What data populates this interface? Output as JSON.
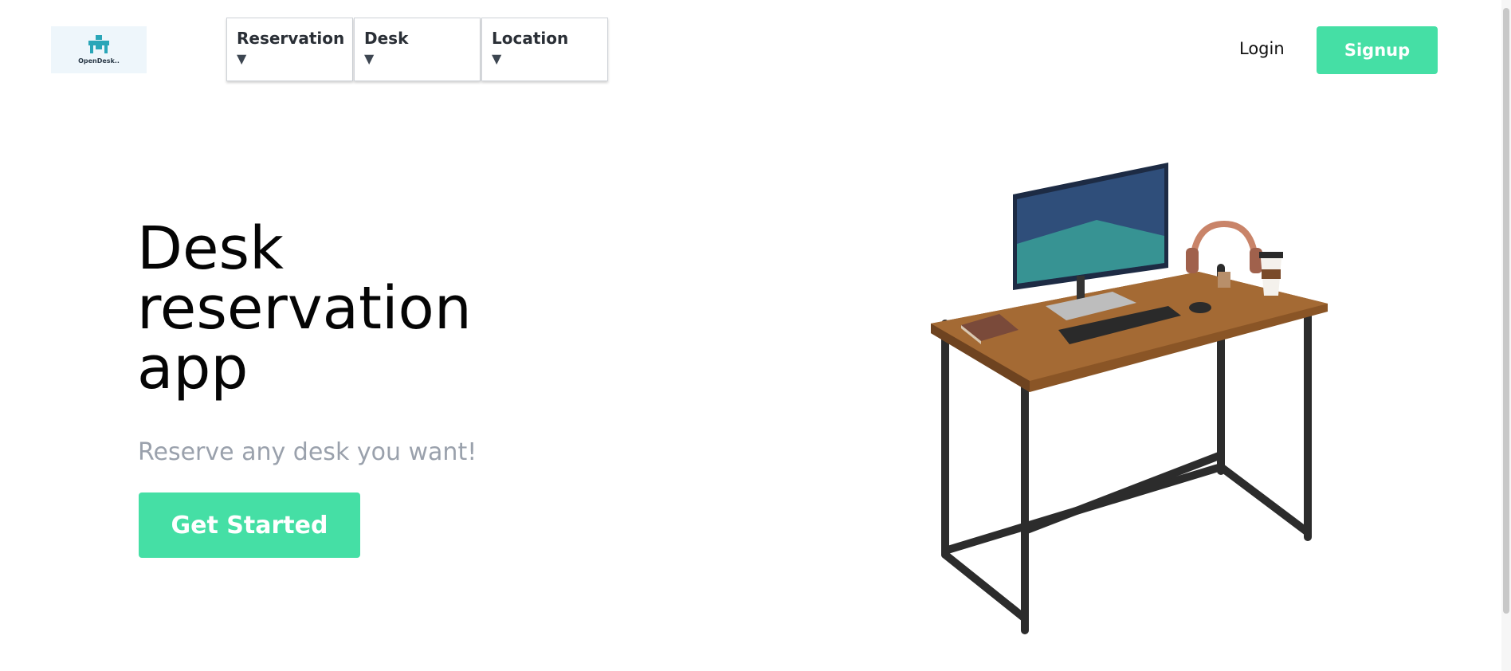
{
  "header": {
    "logo_text": "OpenDesk..",
    "menus": [
      {
        "label": "Reservation",
        "caret": "▼"
      },
      {
        "label": "Desk",
        "caret": "▼"
      },
      {
        "label": "Location",
        "caret": "▼"
      }
    ],
    "login_label": "Login",
    "signup_label": "Signup"
  },
  "hero": {
    "title": "Desk reservation app",
    "subtitle": "Reserve any desk you want!",
    "cta_label": "Get Started"
  },
  "colors": {
    "accent": "#45dfa5",
    "subtitle": "#9aa1ac",
    "logo_bg": "#eef6fb"
  }
}
